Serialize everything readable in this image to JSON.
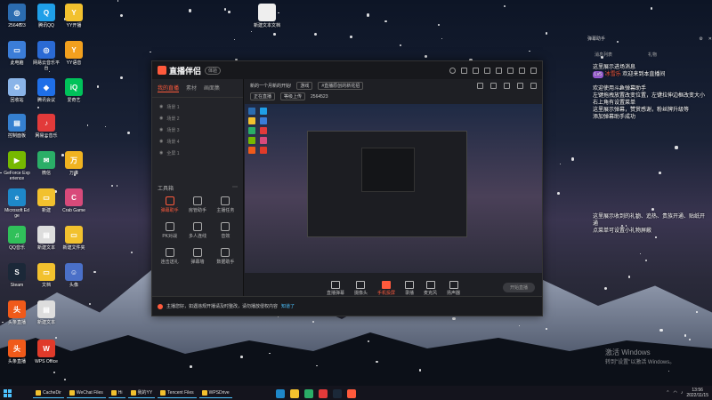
{
  "desktop": {
    "icons": [
      {
        "label": "2564623",
        "color": "#2b6cb0",
        "glyph": "◎"
      },
      {
        "label": "腾讯QQ",
        "color": "#1f9fe8",
        "glyph": "Q"
      },
      {
        "label": "YY开播",
        "color": "#f2c12e",
        "glyph": "Y"
      },
      {
        "label": "此电脑",
        "color": "#3b7dd8",
        "glyph": "▭"
      },
      {
        "label": "网易云音乐平台",
        "color": "#2a6ad4",
        "glyph": "◎"
      },
      {
        "label": "YY语音",
        "color": "#f2a01e",
        "glyph": "Y"
      },
      {
        "label": "回收站",
        "color": "#8ab4e8",
        "glyph": "♻"
      },
      {
        "label": "腾讯会议",
        "color": "#1f6fe8",
        "glyph": "◆"
      },
      {
        "label": "爱奇艺",
        "color": "#00c25a",
        "glyph": "iQ"
      },
      {
        "label": "控制面板",
        "color": "#3580d0",
        "glyph": "▤"
      },
      {
        "label": "网易云音乐",
        "color": "#e23a3a",
        "glyph": "♪"
      },
      {
        "label": "GeForce Experience",
        "color": "#76b900",
        "glyph": "▶"
      },
      {
        "label": "微信",
        "color": "#2aae67",
        "glyph": "✉"
      },
      {
        "label": "万维",
        "color": "#f0b320",
        "glyph": "万"
      },
      {
        "label": "Microsoft Edge",
        "color": "#1e88c9",
        "glyph": "e"
      },
      {
        "label": "新建",
        "color": "#f2c12e",
        "glyph": "▭"
      },
      {
        "label": "Crab Game",
        "color": "#d84a7a",
        "glyph": "C"
      },
      {
        "label": "QQ音乐",
        "color": "#30c05a",
        "glyph": "♫"
      },
      {
        "label": "新建文本",
        "color": "#dddddd",
        "glyph": "▤"
      },
      {
        "label": "新建文件夹",
        "color": "#f2c12e",
        "glyph": "▭"
      },
      {
        "label": "Steam",
        "color": "#1b2838",
        "glyph": "S"
      },
      {
        "label": "文档",
        "color": "#f2c12e",
        "glyph": "▭"
      },
      {
        "label": "头像",
        "color": "#4a70c8",
        "glyph": "☺"
      },
      {
        "label": "头条直播",
        "color": "#f05a1a",
        "glyph": "头"
      },
      {
        "label": "新建文本",
        "color": "#dddddd",
        "glyph": "▤"
      },
      {
        "label": "头条直播",
        "color": "#f05a1a",
        "glyph": "头"
      },
      {
        "label": "WPS Office",
        "color": "#e03a2a",
        "glyph": "W"
      }
    ],
    "top_file": "新建文本文档"
  },
  "app": {
    "title": "直播伴侣",
    "badge": "体验",
    "tabs": [
      "我的直播",
      "素材",
      "画面集"
    ],
    "scenes": [
      "场景 1",
      "场景 2",
      "场景 3",
      "场景 4",
      "全屏 1"
    ],
    "tools_header": "工具箱",
    "tools": [
      {
        "label": "弹幕助手",
        "hl": true
      },
      {
        "label": "房管助手",
        "hl": false
      },
      {
        "label": "主播任务",
        "hl": false
      },
      {
        "label": "PK对战",
        "hl": false
      },
      {
        "label": "多人连线",
        "hl": false
      },
      {
        "label": "音效",
        "hl": false
      },
      {
        "label": "连击送礼",
        "hl": false
      },
      {
        "label": "弹幕墙",
        "hl": false
      },
      {
        "label": "数据助手",
        "hl": false
      }
    ],
    "stream_title": "新的一个月新的开始!",
    "stream_tag": "游戏",
    "stream_desc": "#直播原创的新花招",
    "stream_sub1": "正在直播",
    "stream_sub2": "等级上传",
    "stream_sub3": "2564523",
    "bottom_buttons": [
      {
        "label": "直播弹幕",
        "hl": false
      },
      {
        "label": "摄像头",
        "hl": false
      },
      {
        "label": "手机投屏",
        "hl": true
      },
      {
        "label": "录播",
        "hl": false
      },
      {
        "label": "麦克风",
        "hl": false
      },
      {
        "label": "扬声器",
        "hl": false
      }
    ],
    "start_label": "开始直播",
    "notice": "主播您好，如遇违规开播请及时整改，请勿播放侵权内容",
    "notice_link": "知道了"
  },
  "chat": {
    "header": "弹幕助手",
    "tabs": [
      "消息列表",
      "礼物"
    ],
    "title": "这里展示进场消息",
    "lines": [
      {
        "level": "Lv5",
        "nick": "冰雪乐",
        "text": "欢迎来到本直播间"
      }
    ],
    "tips": "欢迎使用斗鱼弹幕助手\n左键拖拽放置改变位置，左键拉伸边框改变大小\n右上角有设置菜单\n这里展示弹幕，赞赏感谢，粉丝牌升级等\n添加弹幕助手成功",
    "gift_tip": "这里展示收到的礼物、追热、贵族开通、贴纸开通\n点菜单可设置小礼物屏蔽"
  },
  "activate": {
    "line1": "激活 Windows",
    "line2": "转到\"设置\"以激活 Windows。"
  },
  "taskbar": {
    "items": [
      "CacheDir",
      "WeChat Files",
      "Hi",
      "我的YY",
      "Tencent Files",
      "WPSDrive"
    ],
    "time": "13:56",
    "date": "2022/11/15"
  }
}
